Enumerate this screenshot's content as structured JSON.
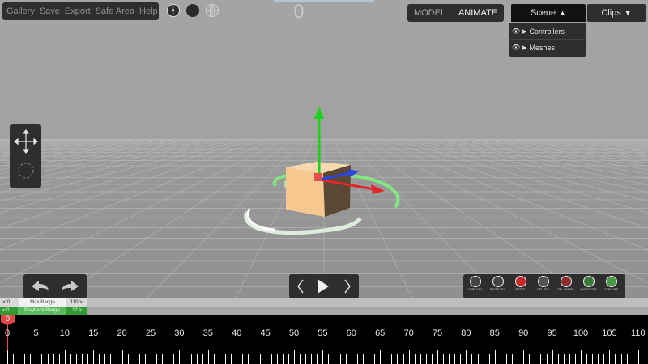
{
  "menu": {
    "items": [
      "Gallery",
      "Save",
      "Export",
      "Safe Area",
      "Help"
    ]
  },
  "view_buttons": [
    "compass-icon",
    "sphere-icon",
    "grid-globe-icon"
  ],
  "frame_display": "0",
  "mode": {
    "model": "MODEL",
    "animate": "ANIMATE",
    "active": "ANIMATE"
  },
  "scene_tab": {
    "label": "Scene",
    "arrow": "▲"
  },
  "clips_tab": {
    "label": "Clips",
    "arrow": "▼"
  },
  "scene_dropdown": {
    "items": [
      {
        "label": "Controllers",
        "eye": "visible-eye-icon",
        "arrow": "▶"
      },
      {
        "label": "Meshes",
        "eye": "visible-eye-icon",
        "arrow": "▶"
      }
    ]
  },
  "tools": [
    "move-icon",
    "rotate-icon"
  ],
  "key_buttons": [
    {
      "label": "COPY KEY",
      "icon": "copy-icon"
    },
    {
      "label": "PASTE KEY",
      "icon": "paste-icon"
    },
    {
      "label": "RESET",
      "icon": "figure-red-icon"
    },
    {
      "label": "DEL KEY",
      "icon": "figure-run-icon"
    },
    {
      "label": "DEL RANGE",
      "icon": "figure-red-run-icon"
    },
    {
      "label": "GHOST OFF",
      "icon": "figure-green-icon"
    },
    {
      "label": "CTRL OFF",
      "icon": "figure-green-stand-icon"
    }
  ],
  "max_range": {
    "start": "|< 0",
    "label": "Max Range",
    "end": "110 >|"
  },
  "playback_range": {
    "start": "< 0",
    "label": "Playback Range",
    "end": "12 >"
  },
  "timeline": {
    "labels": [
      "0",
      "5",
      "10",
      "15",
      "20",
      "25",
      "30",
      "35",
      "40",
      "45",
      "50",
      "55",
      "60",
      "65",
      "70",
      "75",
      "80",
      "85",
      "90",
      "95",
      "100",
      "105",
      "110"
    ],
    "current_frame": "0"
  },
  "colors": {
    "panel": "#2e2e2e",
    "accent_red": "#e24646",
    "range_green": "#3a9a3a",
    "axis_green": "#1ed01e",
    "axis_red": "#e02828",
    "axis_blue": "#2846e0"
  }
}
